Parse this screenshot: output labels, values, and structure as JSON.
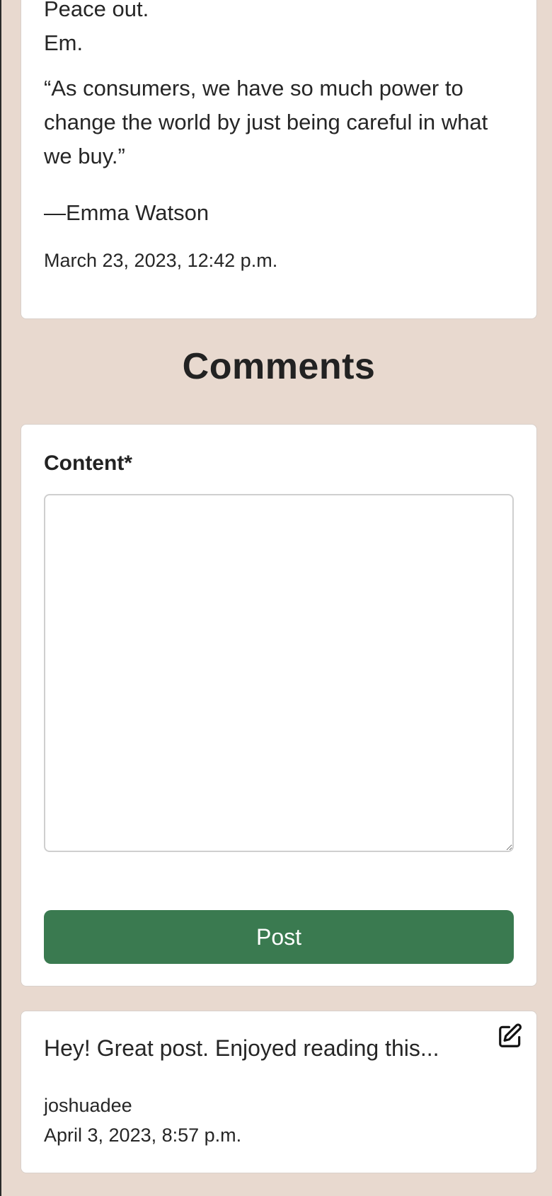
{
  "post": {
    "signoff_line1": "Peace out.",
    "signoff_line2": "Em.",
    "quote": "“As consumers, we have so much power to change the world by just being careful in what we buy.”",
    "attribution": "—Emma Watson",
    "date": "March 23, 2023, 12:42 p.m."
  },
  "comments": {
    "heading": "Comments",
    "form": {
      "content_label": "Content*",
      "content_value": "",
      "post_button_label": "Post"
    },
    "items": [
      {
        "text": "Hey! Great post. Enjoyed reading this...",
        "author": "joshuadee",
        "date": "April 3, 2023, 8:57 p.m.",
        "edit_icon": "edit-icon"
      }
    ]
  },
  "colors": {
    "page_background": "#e8d9cf",
    "card_background": "#ffffff",
    "post_button": "#3a7a50"
  }
}
